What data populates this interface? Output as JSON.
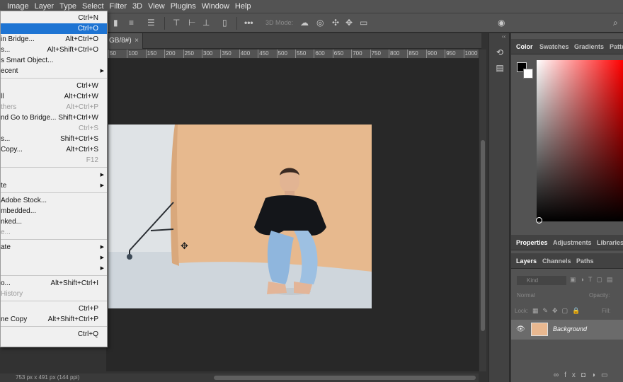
{
  "menubar": {
    "items": [
      "Image",
      "Layer",
      "Type",
      "Select",
      "Filter",
      "3D",
      "View",
      "Plugins",
      "Window",
      "Help"
    ],
    "active_index": -1
  },
  "optionsbar": {
    "mode_label": "3D Mode:"
  },
  "document": {
    "tab_title": "GB/8#)",
    "close_glyph": "×",
    "status": "753 px x 491 px (144 ppi)"
  },
  "ruler": {
    "labels": [
      "50",
      "100",
      "150",
      "200",
      "250",
      "300",
      "350",
      "400",
      "450",
      "500",
      "550",
      "600",
      "650",
      "700",
      "750",
      "800",
      "850",
      "900",
      "950",
      "1000"
    ]
  },
  "file_menu": {
    "items": [
      {
        "label": "",
        "shortcut": "Ctrl+N"
      },
      {
        "label": "",
        "shortcut": "Ctrl+O",
        "highlight": true
      },
      {
        "label": " in Bridge...",
        "shortcut": "Alt+Ctrl+O"
      },
      {
        "label": "s...",
        "shortcut": "Alt+Shift+Ctrl+O"
      },
      {
        "label": "s Smart Object..."
      },
      {
        "label": "ecent",
        "submenu": true
      },
      {
        "separator": true
      },
      {
        "label": "",
        "shortcut": "Ctrl+W"
      },
      {
        "label": "ll",
        "shortcut": "Alt+Ctrl+W"
      },
      {
        "label": "thers",
        "shortcut": "Alt+Ctrl+P",
        "disabled": true
      },
      {
        "label": "nd Go to Bridge...",
        "shortcut": "Shift+Ctrl+W"
      },
      {
        "label": "",
        "shortcut": "Ctrl+S",
        "disabled": true
      },
      {
        "label": "s...",
        "shortcut": "Shift+Ctrl+S"
      },
      {
        "label": "Copy...",
        "shortcut": "Alt+Ctrl+S"
      },
      {
        "label": "",
        "shortcut": "F12",
        "disabled": true
      },
      {
        "separator": true
      },
      {
        "label": "",
        "submenu": true
      },
      {
        "label": "te",
        "submenu": true
      },
      {
        "separator": true
      },
      {
        "label": "Adobe Stock..."
      },
      {
        "label": "mbedded..."
      },
      {
        "label": "nked..."
      },
      {
        "label": "e...",
        "disabled": true
      },
      {
        "separator": true
      },
      {
        "label": "ate",
        "submenu": true
      },
      {
        "label": "",
        "submenu": true
      },
      {
        "label": "",
        "submenu": true
      },
      {
        "separator": true
      },
      {
        "label": "o...",
        "shortcut": "Alt+Shift+Ctrl+I"
      },
      {
        "label": " History",
        "disabled": true
      },
      {
        "separator": true
      },
      {
        "label": "",
        "shortcut": "Ctrl+P"
      },
      {
        "label": "ne Copy",
        "shortcut": "Alt+Shift+Ctrl+P"
      },
      {
        "separator": true
      },
      {
        "label": "",
        "shortcut": "Ctrl+Q"
      }
    ]
  },
  "panels": {
    "color_tabs": [
      "Color",
      "Swatches",
      "Gradients",
      "Patte"
    ],
    "properties_tabs": [
      "Properties",
      "Adjustments",
      "Libraries"
    ],
    "layers_tabs": [
      "Layers",
      "Channels",
      "Paths"
    ],
    "kind_placeholder": "Kind",
    "blend_mode": "Normal",
    "opacity_label": "Opacity:",
    "lock_label": "Lock:",
    "fill_label": "Fill:",
    "layer_name": "Background"
  },
  "colors": {
    "highlight": "#1e74d3",
    "foreground": "#000000",
    "background": "#ffffff"
  }
}
